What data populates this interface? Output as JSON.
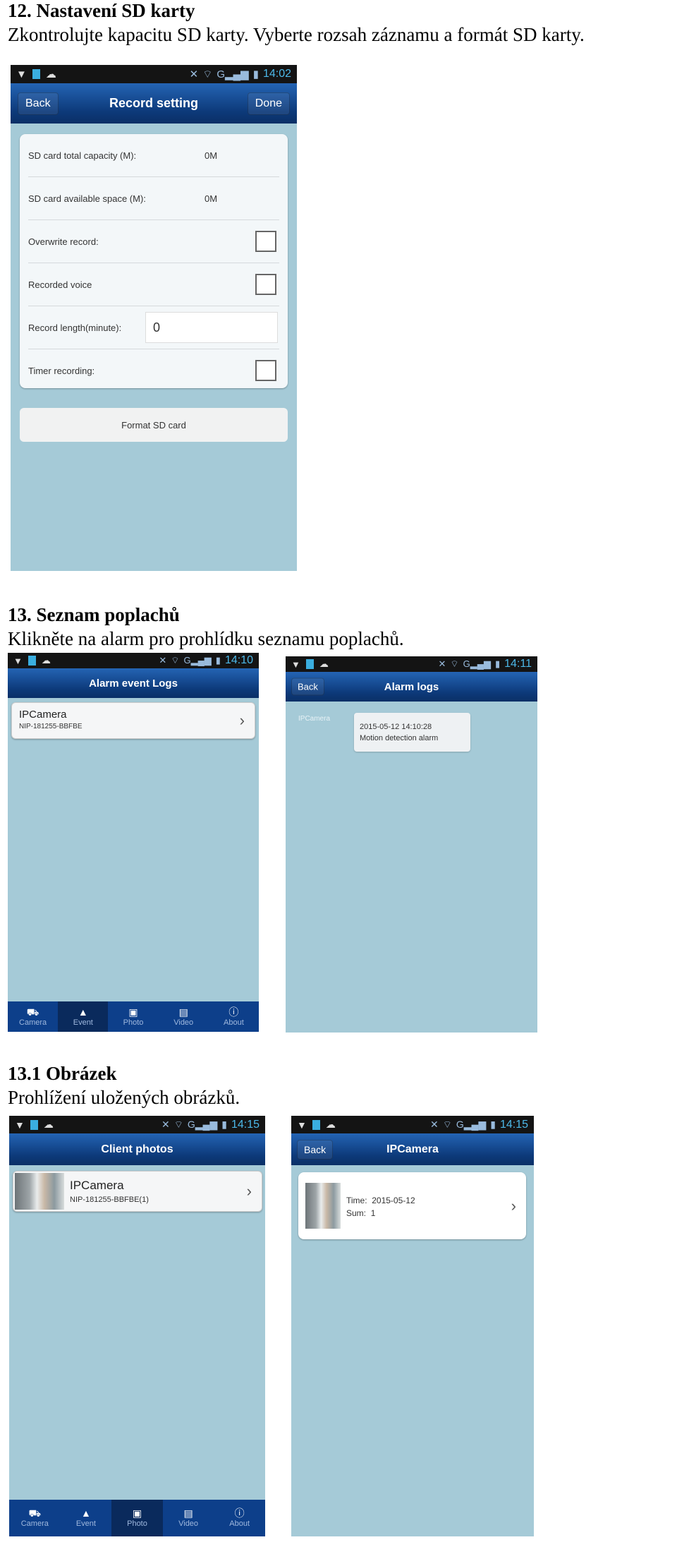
{
  "sections": [
    {
      "heading": "12. Nastavení SD karty",
      "text": "Zkontrolujte kapacitu SD karty. Vyberte rozsah záznamu a formát SD karty."
    },
    {
      "heading": "13. Seznam poplachů",
      "text": "Klikněte na alarm pro prohlídku seznamu poplachů."
    },
    {
      "heading": "13.1 Obrázek",
      "text": "Prohlížení uložených obrázků."
    }
  ],
  "colors": {
    "status_bar": "#141414",
    "nav_bar": "#0d3a7a",
    "background": "#a5cad7",
    "tab_bar": "#0d3f8a"
  },
  "record_setting": {
    "time": "14:02",
    "title": "Record setting",
    "back": "Back",
    "done": "Done",
    "total_label": "SD card total capacity (M):",
    "total_value": "0M",
    "avail_label": "SD card available space (M):",
    "avail_value": "0M",
    "overwrite_label": "Overwrite record:",
    "overwrite_checked": false,
    "voice_label": "Recorded voice",
    "voice_checked": false,
    "length_label": "Record length(minute):",
    "length_value": "0",
    "timer_label": "Timer recording:",
    "timer_checked": false,
    "format_button": "Format SD card"
  },
  "alarm_event_logs": {
    "time": "14:10",
    "title": "Alarm event Logs",
    "item_name": "IPCamera",
    "item_id": "NIP-181255-BBFBE"
  },
  "alarm_logs": {
    "time": "14:11",
    "title": "Alarm logs",
    "back": "Back",
    "camera": "IPCamera",
    "datetime": "2015-05-12 14:10:28",
    "message": "Motion detection alarm"
  },
  "client_photos": {
    "time": "14:15",
    "title": "Client photos",
    "item_name": "IPCamera",
    "item_id": "NIP-181255-BBFBE(1)"
  },
  "camera_photos": {
    "time": "14:15",
    "title": "IPCamera",
    "back": "Back",
    "time_label": "Time:",
    "time_value": "2015-05-12",
    "sum_label": "Sum:",
    "sum_value": "1"
  },
  "tabs": [
    {
      "label": "Camera",
      "icon": "camera-icon"
    },
    {
      "label": "Event",
      "icon": "alarm-bell-icon"
    },
    {
      "label": "Photo",
      "icon": "photo-icon"
    },
    {
      "label": "Video",
      "icon": "video-icon"
    },
    {
      "label": "About",
      "icon": "info-icon"
    }
  ],
  "tabs_active_event": "Event",
  "tabs_active_photo": "Photo"
}
